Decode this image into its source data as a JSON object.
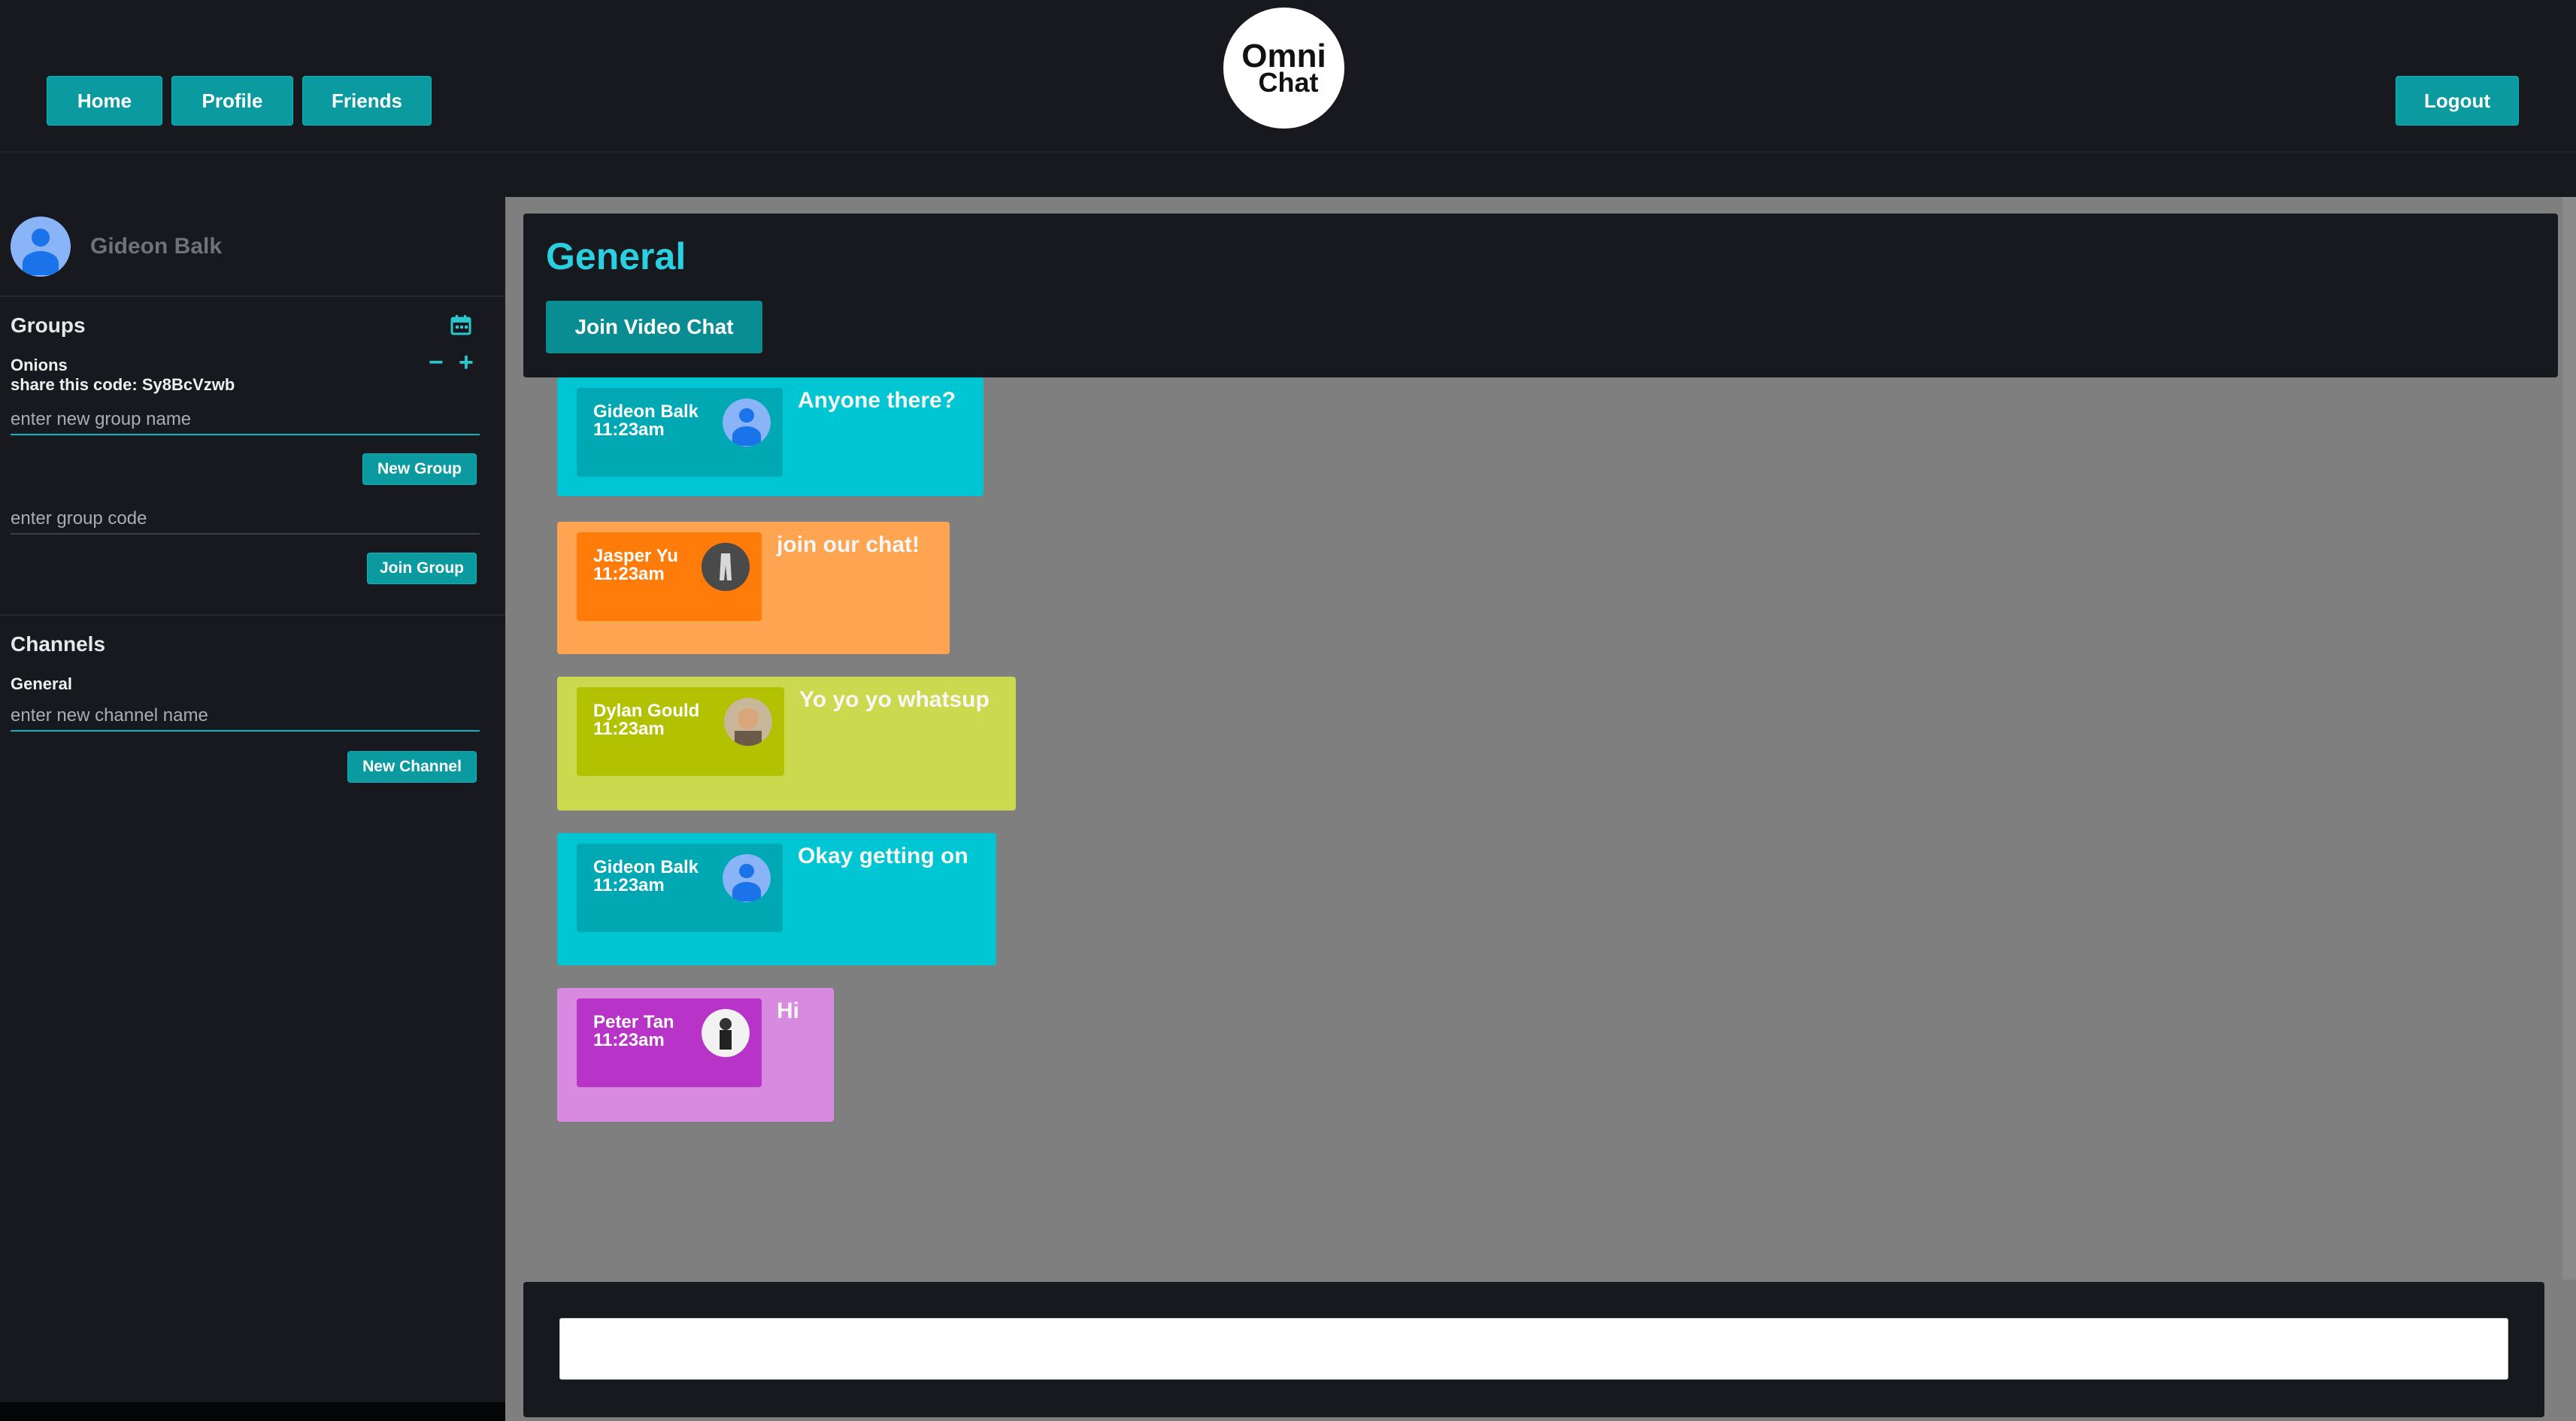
{
  "nav": {
    "home_label": "Home",
    "profile_label": "Profile",
    "friends_label": "Friends",
    "logout_label": "Logout",
    "logo_line1": "Omni",
    "logo_line2": "Chat"
  },
  "sidebar": {
    "user_name": "Gideon Balk",
    "groups_title": "Groups",
    "group_name": "Onions",
    "share_code_text": "share this code: Sy8BcVzwb",
    "new_group_placeholder": "enter new group name",
    "new_group_button": "New Group",
    "group_code_placeholder": "enter group code",
    "join_group_button": "Join Group",
    "channels_title": "Channels",
    "channel_name": "General",
    "new_channel_placeholder": "enter new channel name",
    "new_channel_button": "New Channel"
  },
  "channel": {
    "title": "General",
    "video_button": "Join Video Chat"
  },
  "messages": [
    {
      "author": "Gideon Balk",
      "time": "11:23am",
      "text": "Anyone there?",
      "color": "#00c5d2",
      "inner_color": "#00a8b3"
    },
    {
      "author": "Jasper Yu",
      "time": "11:23am",
      "text": "join our chat!",
      "color": "#ffa552",
      "inner_color": "#ff7b0a"
    },
    {
      "author": "Dylan Gould",
      "time": "11:23am",
      "text": "Yo yo yo whatsup",
      "color": "#cbd94e",
      "inner_color": "#b3c200"
    },
    {
      "author": "Gideon Balk",
      "time": "11:23am",
      "text": "Okay getting on",
      "color": "#00c5d2",
      "inner_color": "#00a8b3"
    },
    {
      "author": "Peter Tan",
      "time": "11:23am",
      "text": "Hi",
      "color": "#d88ae0",
      "inner_color": "#b834c9"
    }
  ],
  "composer": {
    "placeholder": ""
  },
  "colors": {
    "accent": "#0a9aa0",
    "channel_title": "#2bd0e0"
  }
}
